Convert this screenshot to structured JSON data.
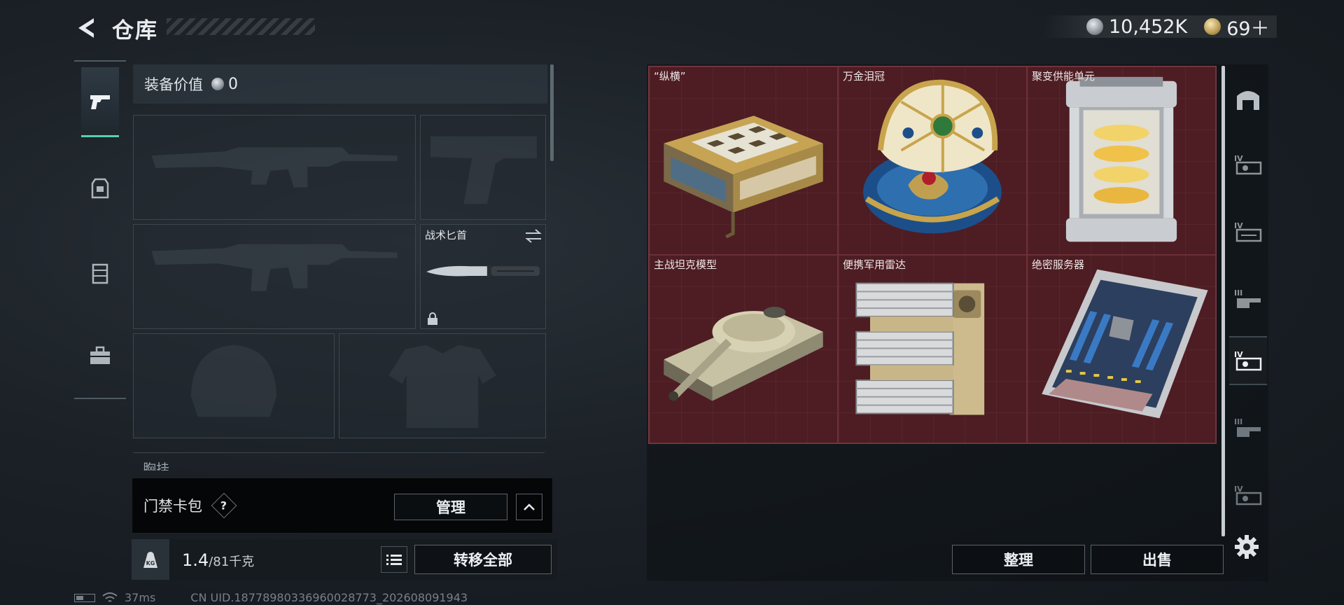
{
  "header": {
    "title": "仓库",
    "currency_silver": "10,452K",
    "currency_gold": "69＋"
  },
  "equipment": {
    "value_label": "装备价值",
    "value": "0",
    "knife_slot_label": "战术匕首",
    "chest_label": "胸挂"
  },
  "access_card": {
    "label": "门禁卡包",
    "help": "?",
    "manage_label": "管理"
  },
  "weight": {
    "current": "1.4",
    "max": "/81千克"
  },
  "actions": {
    "transfer_all": "转移全部",
    "sort": "整理",
    "sell": "出售"
  },
  "status": {
    "ping": "37ms",
    "uid": "CN UID.18778980336960028773_202608091943"
  },
  "storage": {
    "items": [
      {
        "name": "“纵横”",
        "icon": "chess-box-icon"
      },
      {
        "name": "万金泪冠",
        "icon": "jeweled-egg-icon"
      },
      {
        "name": "聚变供能单元",
        "icon": "fusion-cell-icon"
      },
      {
        "name": "主战坦克模型",
        "icon": "tank-model-icon"
      },
      {
        "name": "便携军用雷达",
        "icon": "radar-icon"
      },
      {
        "name": "绝密服务器",
        "icon": "server-icon"
      }
    ],
    "cell_color": "#4d1d23"
  },
  "accent_color": "#58d0b0"
}
